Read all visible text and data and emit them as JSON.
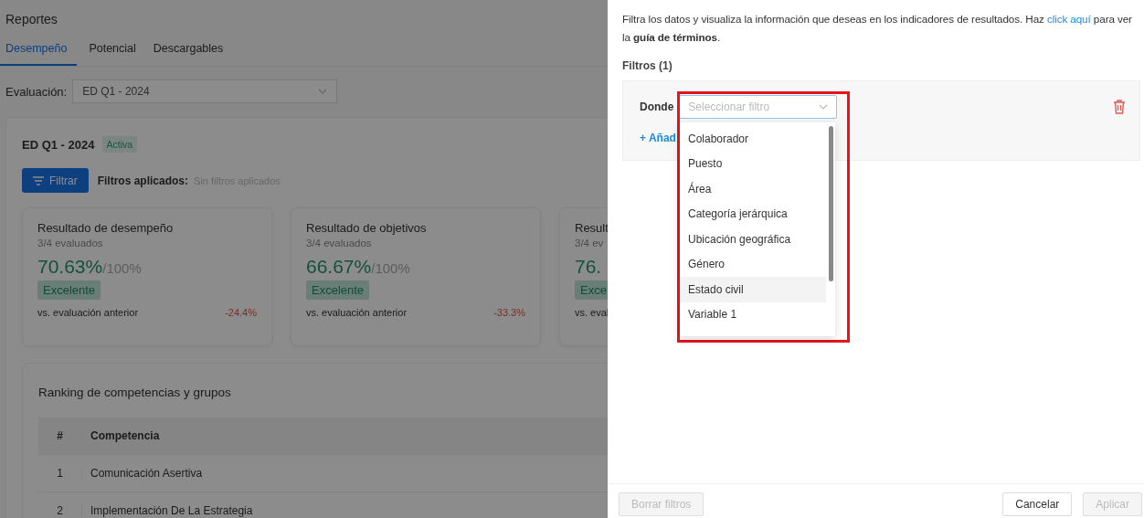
{
  "page": {
    "title": "Reportes"
  },
  "tabs": [
    {
      "label": "Desempeño",
      "selected": true
    },
    {
      "label": "Potencial",
      "selected": false
    },
    {
      "label": "Descargables",
      "selected": false
    }
  ],
  "evaluation": {
    "label": "Evaluación:",
    "value": "ED Q1 - 2024"
  },
  "summary": {
    "title": "ED Q1 - 2024",
    "status": "Activa",
    "filter_button": "Filtrar",
    "applied_label": "Filtros aplicados:",
    "applied_value": "Sin filtros aplicados"
  },
  "metrics": [
    {
      "title": "Resultado de desempeño",
      "evaluated": "3/4 evaluados",
      "value": "70.63%",
      "max": "/100%",
      "rating": "Excelente",
      "comparison": "vs. evaluación anterior",
      "change": "-24.4%"
    },
    {
      "title": "Resultado de objetivos",
      "evaluated": "3/4 evaluados",
      "value": "66.67%",
      "max": "/100%",
      "rating": "Excelente",
      "comparison": "vs. evaluación anterior",
      "change": "-33.3%"
    },
    {
      "title": "Result",
      "evaluated": "3/4 ev",
      "value": "76.",
      "rating": "Exce",
      "comparison": "vs. eval"
    }
  ],
  "ranking": {
    "title": "Ranking de competencias y grupos",
    "columns": [
      "#",
      "Competencia"
    ],
    "rows": [
      [
        "1",
        "Comunicación Asertiva"
      ],
      [
        "2",
        "Implementación De La Estrategia"
      ]
    ]
  },
  "drawer": {
    "intro_before": "Filtra los datos y visualiza la información que deseas en los indicadores de resultados. Haz ",
    "intro_link": "click aquí",
    "intro_after": " para ver la **guía de términos**.",
    "filters_title": "Filtros (1)",
    "where_label": "Donde",
    "select_placeholder": "Seleccionar filtro",
    "add_link": "+ Añad",
    "options": [
      {
        "label": "Colaborador",
        "selected": false
      },
      {
        "label": "Puesto",
        "selected": false
      },
      {
        "label": "Área",
        "selected": false
      },
      {
        "label": "Categoría jerárquica",
        "selected": false
      },
      {
        "label": "Ubicación geográfica",
        "selected": false
      },
      {
        "label": "Género",
        "selected": false
      },
      {
        "label": "Estado civil",
        "selected": true
      },
      {
        "label": "Variable 1",
        "selected": false
      }
    ],
    "buttons": [
      {
        "label": "Borrar filtros",
        "disabled": true
      },
      {
        "label": "Cancelar",
        "disabled": false
      },
      {
        "label": "Aplicar",
        "disabled": true
      }
    ]
  }
}
